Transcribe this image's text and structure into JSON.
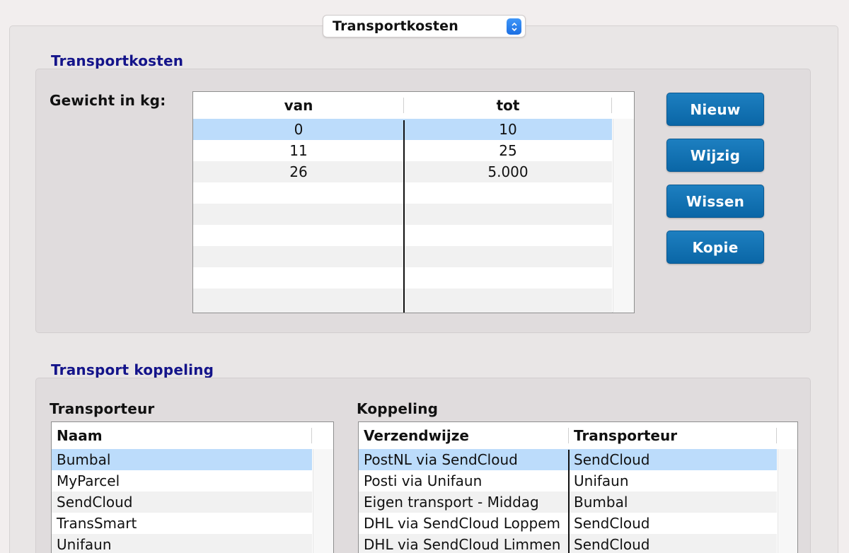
{
  "selector": {
    "value": "Transportkosten"
  },
  "transportkosten": {
    "title": "Transportkosten",
    "weight_label": "Gewicht in kg:",
    "columns": [
      "van",
      "tot"
    ],
    "rows": [
      {
        "van": "0",
        "tot": "10"
      },
      {
        "van": "11",
        "tot": "25"
      },
      {
        "van": "26",
        "tot": "5.000"
      }
    ],
    "buttons": {
      "new": "Nieuw",
      "edit": "Wijzig",
      "delete": "Wissen",
      "copy": "Kopie"
    }
  },
  "koppeling": {
    "title": "Transport koppeling",
    "carrier_label": "Transporteur",
    "link_label": "Koppeling",
    "carriers": {
      "column": "Naam",
      "rows": [
        "Bumbal",
        "MyParcel",
        "SendCloud",
        "TransSmart",
        "Unifaun"
      ]
    },
    "links": {
      "columns": [
        "Verzendwijze",
        "Transporteur"
      ],
      "rows": [
        {
          "method": "PostNL via SendCloud",
          "carrier": "SendCloud"
        },
        {
          "method": "Posti via Unifaun",
          "carrier": "Unifaun"
        },
        {
          "method": "Eigen transport - Middag",
          "carrier": "Bumbal"
        },
        {
          "method": "DHL via SendCloud Loppem",
          "carrier": "SendCloud"
        },
        {
          "method": "DHL via SendCloud Limmen",
          "carrier": "SendCloud"
        }
      ]
    }
  },
  "colors": {
    "accent": "#0b6aa9",
    "title": "#14148a",
    "selection": "#bcdcfb"
  }
}
